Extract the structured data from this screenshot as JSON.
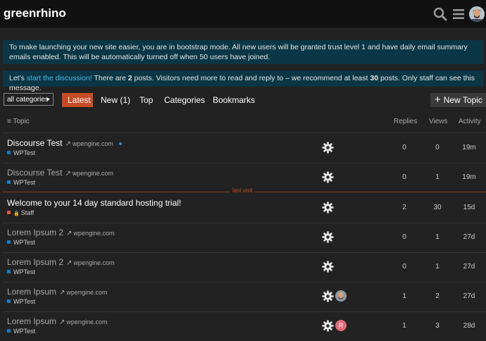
{
  "header": {
    "site_name": "greenrhino",
    "search_icon": "search-icon",
    "menu_icon": "hamburger-icon"
  },
  "banners": {
    "bootstrap": "To make launching your new site easier, you are in bootstrap mode. All new users will be granted trust level 1 and have daily email summary emails enabled. This will be automatically turned off when 50 users have joined.",
    "discussion_prefix": "Let's",
    "discussion_link": "start the discussion!",
    "discussion_mid1": "There are",
    "posts_count": "2",
    "discussion_mid2": "posts. Visitors need more to read and reply to – we recommend at least",
    "recommended_count": "30",
    "discussion_suffix": "posts. Only staff can see this message."
  },
  "nav": {
    "category_dropdown": "all categories",
    "tabs": [
      "Latest",
      "New (1)",
      "Top",
      "Categories",
      "Bookmarks"
    ],
    "active_tab": "Latest",
    "new_topic": "New Topic"
  },
  "table": {
    "headers": {
      "topic": "Topic",
      "replies": "Replies",
      "views": "Views",
      "activity": "Activity"
    },
    "last_visit_label": "last visit",
    "rows": [
      {
        "title": "Discourse Test",
        "domain": "wpengine.com",
        "category": "WPTest",
        "cat_color": "#0e80c8",
        "replies": "0",
        "views": "0",
        "activity": "19m",
        "unread": true,
        "new_dot": true
      },
      {
        "title": "Discourse Test",
        "domain": "wpengine.com",
        "category": "WPTest",
        "cat_color": "#0e80c8",
        "replies": "0",
        "views": "1",
        "activity": "19m",
        "unread": false
      },
      {
        "title": "Welcome to your 14 day standard hosting trial!",
        "domain": "",
        "category": "Staff",
        "cat_color": "#e45735",
        "locked": true,
        "replies": "2",
        "views": "30",
        "activity": "15d",
        "unread": true
      },
      {
        "title": "Lorem Ipsum 2",
        "domain": "wpengine.com",
        "category": "WPTest",
        "cat_color": "#0e80c8",
        "replies": "0",
        "views": "1",
        "activity": "27d",
        "unread": false
      },
      {
        "title": "Lorem Ipsum 2",
        "domain": "wpengine.com",
        "category": "WPTest",
        "cat_color": "#0e80c8",
        "replies": "0",
        "views": "1",
        "activity": "27d",
        "unread": false
      },
      {
        "title": "Lorem Ipsum",
        "domain": "wpengine.com",
        "category": "WPTest",
        "cat_color": "#0e80c8",
        "replies": "1",
        "views": "2",
        "activity": "27d",
        "unread": false,
        "extra_poster": "avatar-photo"
      },
      {
        "title": "Lorem Ipsum",
        "domain": "wpengine.com",
        "category": "WPTest",
        "cat_color": "#0e80c8",
        "replies": "1",
        "views": "3",
        "activity": "28d",
        "unread": false,
        "extra_poster": "letter",
        "extra_letter": "R"
      }
    ]
  },
  "colors": {
    "accent": "#c84b25",
    "banner_bg": "#0a3646",
    "link": "#4cb8e5"
  }
}
